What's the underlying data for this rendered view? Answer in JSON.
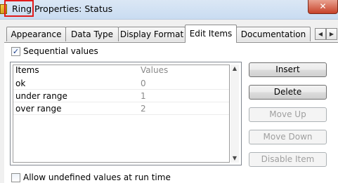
{
  "window": {
    "title": "Ring Properties: Status",
    "close_glyph": "✕"
  },
  "tabs": [
    {
      "label": "Appearance",
      "active": false
    },
    {
      "label": "Data Type",
      "active": false
    },
    {
      "label": "Display Format",
      "active": false
    },
    {
      "label": "Edit Items",
      "active": true
    },
    {
      "label": "Documentation",
      "active": false
    }
  ],
  "tab_scroll": {
    "left_glyph": "◀",
    "right_glyph": "▶"
  },
  "sequential": {
    "label": "Sequential values",
    "checked": true,
    "check_glyph": "✓"
  },
  "table": {
    "headers": {
      "items": "Items",
      "values": "Values"
    },
    "rows": [
      {
        "item": "ok",
        "value": "0"
      },
      {
        "item": "under range",
        "value": "1"
      },
      {
        "item": "over range",
        "value": "2"
      }
    ]
  },
  "scrollbar": {
    "up_glyph": "▲",
    "down_glyph": "▼"
  },
  "buttons": {
    "insert": "Insert",
    "delete": "Delete",
    "move_up": "Move Up",
    "move_down": "Move Down",
    "disable_item": "Disable Item"
  },
  "bottom_option": {
    "label": "Allow undefined values at run time",
    "checked": false
  }
}
